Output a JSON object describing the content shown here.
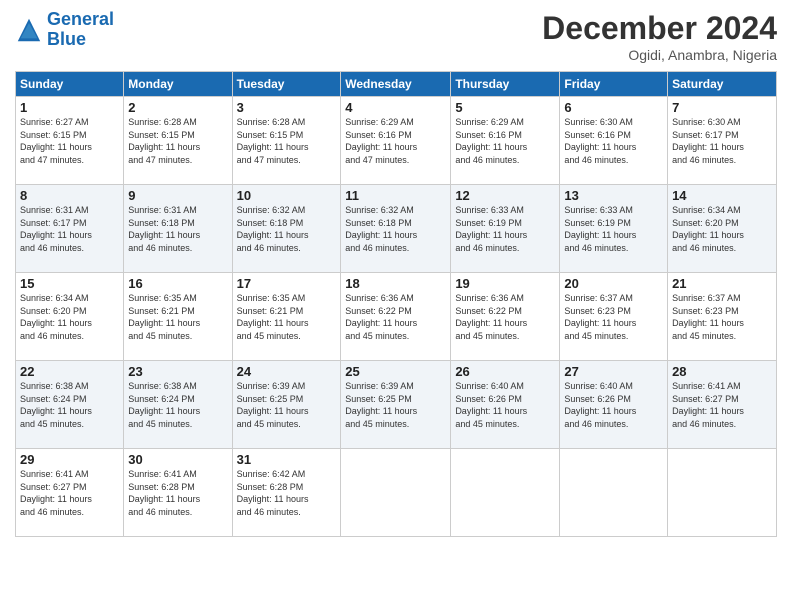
{
  "logo": {
    "line1": "General",
    "line2": "Blue"
  },
  "title": "December 2024",
  "subtitle": "Ogidi, Anambra, Nigeria",
  "days_of_week": [
    "Sunday",
    "Monday",
    "Tuesday",
    "Wednesday",
    "Thursday",
    "Friday",
    "Saturday"
  ],
  "weeks": [
    [
      {
        "day": "1",
        "info": "Sunrise: 6:27 AM\nSunset: 6:15 PM\nDaylight: 11 hours\nand 47 minutes."
      },
      {
        "day": "2",
        "info": "Sunrise: 6:28 AM\nSunset: 6:15 PM\nDaylight: 11 hours\nand 47 minutes."
      },
      {
        "day": "3",
        "info": "Sunrise: 6:28 AM\nSunset: 6:15 PM\nDaylight: 11 hours\nand 47 minutes."
      },
      {
        "day": "4",
        "info": "Sunrise: 6:29 AM\nSunset: 6:16 PM\nDaylight: 11 hours\nand 47 minutes."
      },
      {
        "day": "5",
        "info": "Sunrise: 6:29 AM\nSunset: 6:16 PM\nDaylight: 11 hours\nand 46 minutes."
      },
      {
        "day": "6",
        "info": "Sunrise: 6:30 AM\nSunset: 6:16 PM\nDaylight: 11 hours\nand 46 minutes."
      },
      {
        "day": "7",
        "info": "Sunrise: 6:30 AM\nSunset: 6:17 PM\nDaylight: 11 hours\nand 46 minutes."
      }
    ],
    [
      {
        "day": "8",
        "info": "Sunrise: 6:31 AM\nSunset: 6:17 PM\nDaylight: 11 hours\nand 46 minutes."
      },
      {
        "day": "9",
        "info": "Sunrise: 6:31 AM\nSunset: 6:18 PM\nDaylight: 11 hours\nand 46 minutes."
      },
      {
        "day": "10",
        "info": "Sunrise: 6:32 AM\nSunset: 6:18 PM\nDaylight: 11 hours\nand 46 minutes."
      },
      {
        "day": "11",
        "info": "Sunrise: 6:32 AM\nSunset: 6:18 PM\nDaylight: 11 hours\nand 46 minutes."
      },
      {
        "day": "12",
        "info": "Sunrise: 6:33 AM\nSunset: 6:19 PM\nDaylight: 11 hours\nand 46 minutes."
      },
      {
        "day": "13",
        "info": "Sunrise: 6:33 AM\nSunset: 6:19 PM\nDaylight: 11 hours\nand 46 minutes."
      },
      {
        "day": "14",
        "info": "Sunrise: 6:34 AM\nSunset: 6:20 PM\nDaylight: 11 hours\nand 46 minutes."
      }
    ],
    [
      {
        "day": "15",
        "info": "Sunrise: 6:34 AM\nSunset: 6:20 PM\nDaylight: 11 hours\nand 46 minutes."
      },
      {
        "day": "16",
        "info": "Sunrise: 6:35 AM\nSunset: 6:21 PM\nDaylight: 11 hours\nand 45 minutes."
      },
      {
        "day": "17",
        "info": "Sunrise: 6:35 AM\nSunset: 6:21 PM\nDaylight: 11 hours\nand 45 minutes."
      },
      {
        "day": "18",
        "info": "Sunrise: 6:36 AM\nSunset: 6:22 PM\nDaylight: 11 hours\nand 45 minutes."
      },
      {
        "day": "19",
        "info": "Sunrise: 6:36 AM\nSunset: 6:22 PM\nDaylight: 11 hours\nand 45 minutes."
      },
      {
        "day": "20",
        "info": "Sunrise: 6:37 AM\nSunset: 6:23 PM\nDaylight: 11 hours\nand 45 minutes."
      },
      {
        "day": "21",
        "info": "Sunrise: 6:37 AM\nSunset: 6:23 PM\nDaylight: 11 hours\nand 45 minutes."
      }
    ],
    [
      {
        "day": "22",
        "info": "Sunrise: 6:38 AM\nSunset: 6:24 PM\nDaylight: 11 hours\nand 45 minutes."
      },
      {
        "day": "23",
        "info": "Sunrise: 6:38 AM\nSunset: 6:24 PM\nDaylight: 11 hours\nand 45 minutes."
      },
      {
        "day": "24",
        "info": "Sunrise: 6:39 AM\nSunset: 6:25 PM\nDaylight: 11 hours\nand 45 minutes."
      },
      {
        "day": "25",
        "info": "Sunrise: 6:39 AM\nSunset: 6:25 PM\nDaylight: 11 hours\nand 45 minutes."
      },
      {
        "day": "26",
        "info": "Sunrise: 6:40 AM\nSunset: 6:26 PM\nDaylight: 11 hours\nand 45 minutes."
      },
      {
        "day": "27",
        "info": "Sunrise: 6:40 AM\nSunset: 6:26 PM\nDaylight: 11 hours\nand 46 minutes."
      },
      {
        "day": "28",
        "info": "Sunrise: 6:41 AM\nSunset: 6:27 PM\nDaylight: 11 hours\nand 46 minutes."
      }
    ],
    [
      {
        "day": "29",
        "info": "Sunrise: 6:41 AM\nSunset: 6:27 PM\nDaylight: 11 hours\nand 46 minutes."
      },
      {
        "day": "30",
        "info": "Sunrise: 6:41 AM\nSunset: 6:28 PM\nDaylight: 11 hours\nand 46 minutes."
      },
      {
        "day": "31",
        "info": "Sunrise: 6:42 AM\nSunset: 6:28 PM\nDaylight: 11 hours\nand 46 minutes."
      },
      {
        "day": "",
        "info": ""
      },
      {
        "day": "",
        "info": ""
      },
      {
        "day": "",
        "info": ""
      },
      {
        "day": "",
        "info": ""
      }
    ]
  ]
}
